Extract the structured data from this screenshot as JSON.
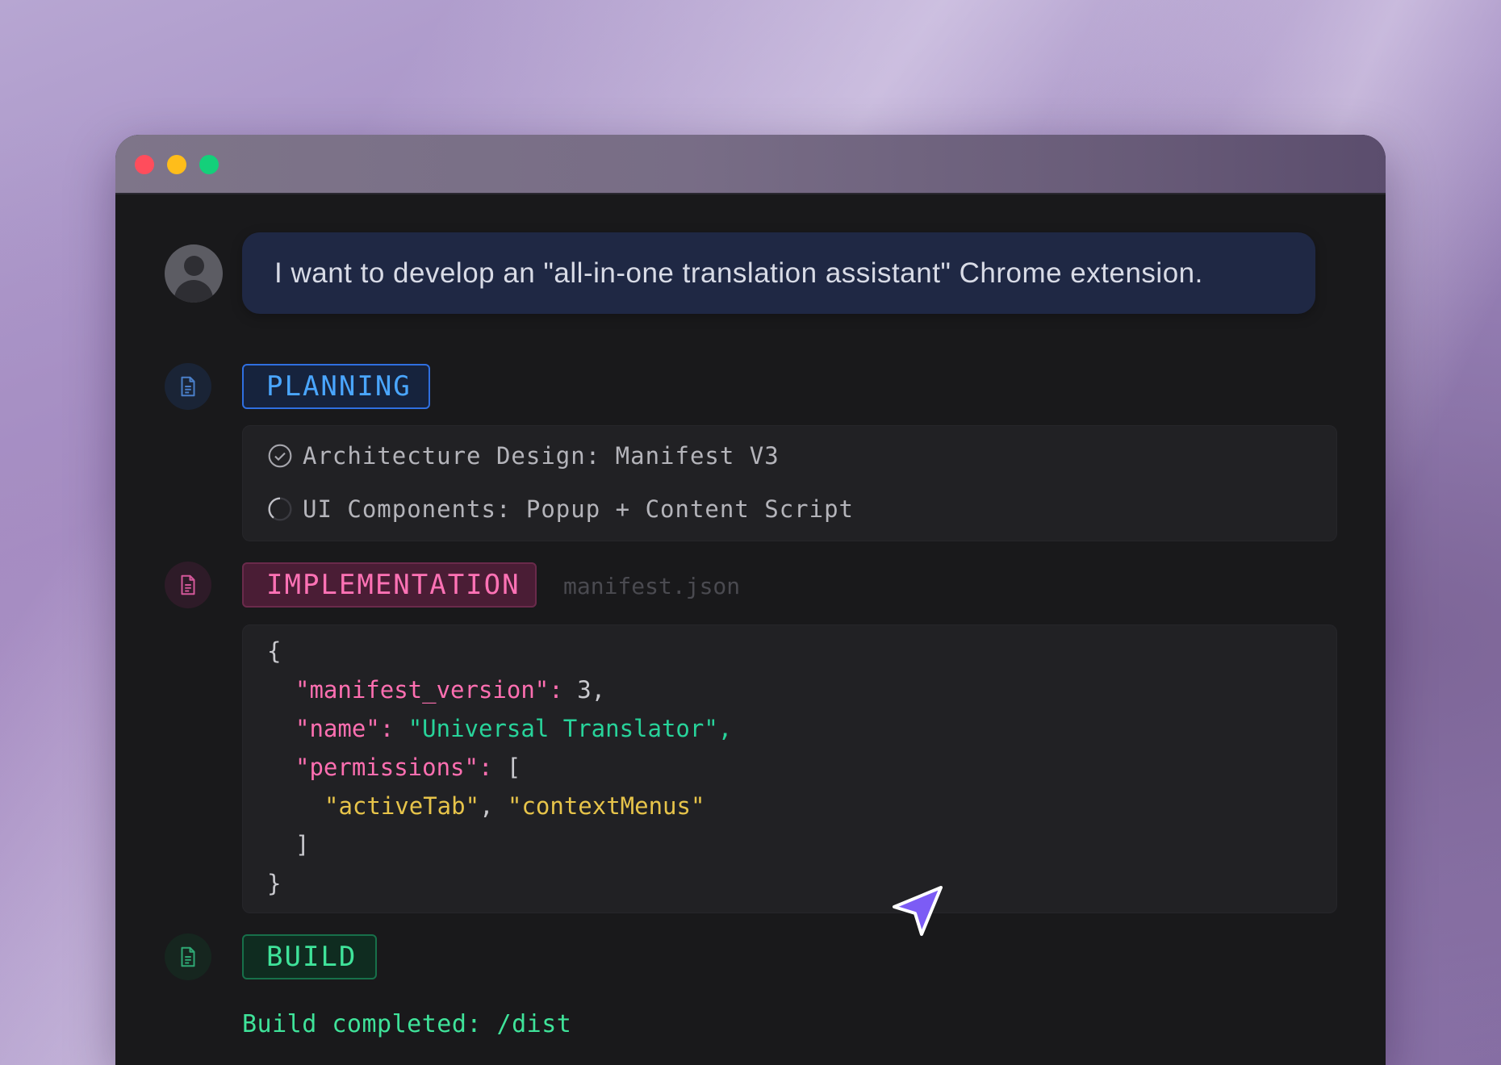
{
  "window": {
    "controls": [
      "close",
      "minimize",
      "maximize"
    ]
  },
  "chat": {
    "message": "I want to develop an \"all-in-one translation assistant\" Chrome extension."
  },
  "planning": {
    "label": "PLANNING",
    "items": [
      {
        "text": "Architecture Design: Manifest V3",
        "status": "done"
      },
      {
        "text": "UI Components: Popup + Content Script",
        "status": "in-progress"
      }
    ]
  },
  "implementation": {
    "label": "IMPLEMENTATION",
    "filename": "manifest.json",
    "code": {
      "open": "{",
      "k1": "\"manifest_version\"",
      "v1": "3",
      "k2": "\"name\"",
      "v2": "\"Universal Translator\"",
      "k3": "\"permissions\"",
      "arr_open": "[",
      "p1": "\"activeTab\"",
      "p2": "\"contextMenus\"",
      "arr_close": "]",
      "close": "}"
    }
  },
  "build": {
    "label": "BUILD",
    "message": "Build completed: /dist"
  },
  "colors": {
    "planning": "#4aa6ff",
    "implementation": "#ff72b5",
    "build": "#3fe39a",
    "bubble": "#1f2844",
    "cursor": "#7c5cf5"
  }
}
